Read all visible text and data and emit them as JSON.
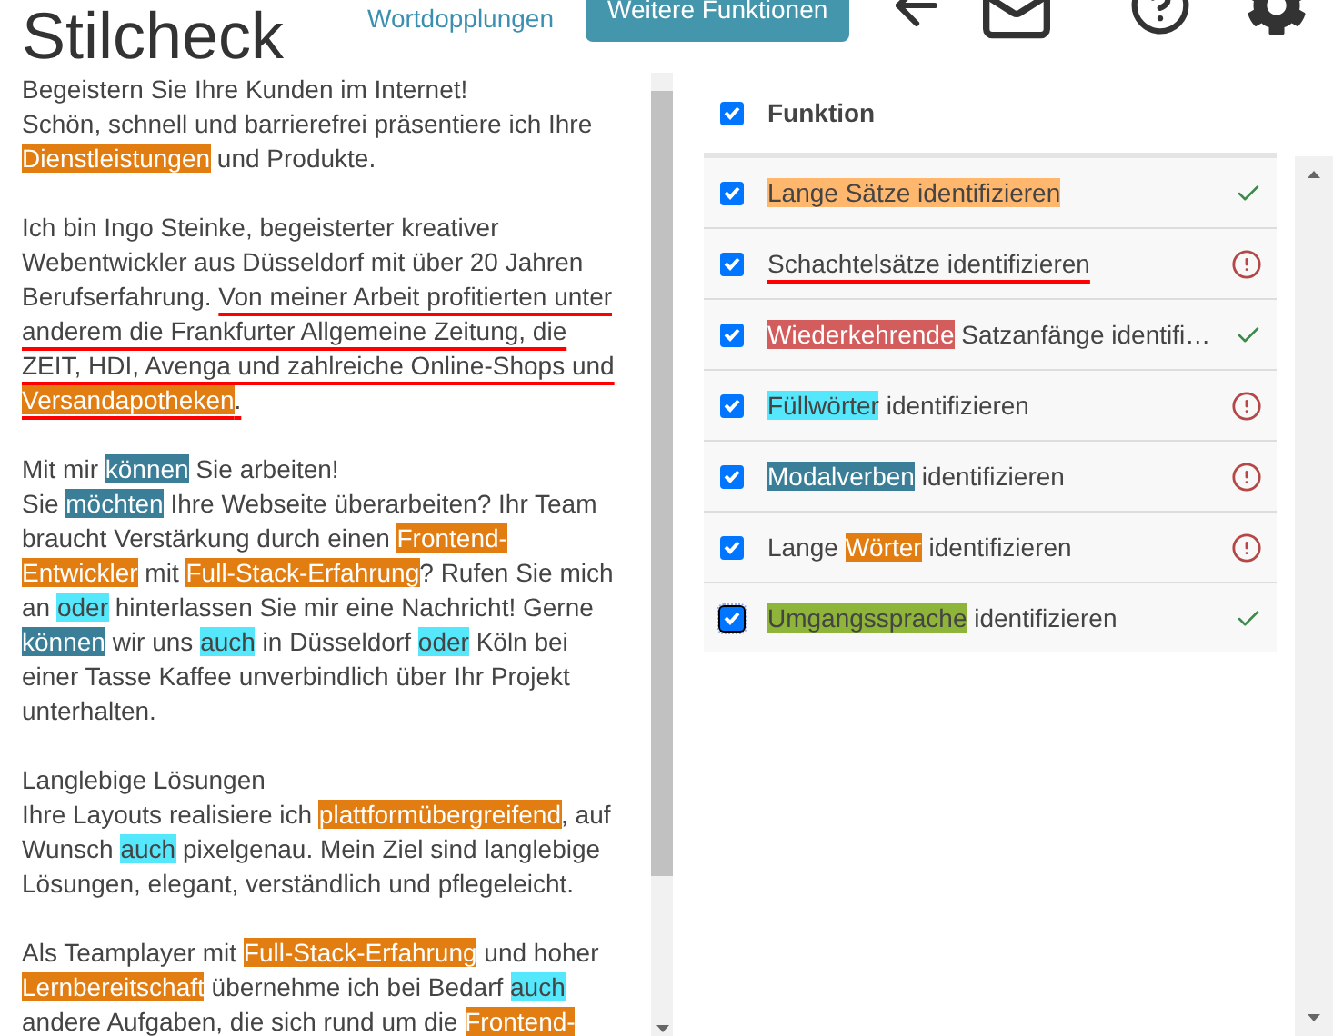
{
  "header": {
    "title": "Stilcheck",
    "link": "Wortdopplungen",
    "button": "Weitere Funktionen"
  },
  "text": [
    {
      "lines": [
        [
          {
            "kind": "plain",
            "text": "Begeistern Sie Ihre Kunden im Internet!"
          }
        ],
        [
          {
            "kind": "plain",
            "text": "Schön, schnell und barrierefrei präsentiere ich Ihre "
          },
          {
            "kind": "long_word",
            "text": "Dienstleistungen"
          },
          {
            "kind": "plain",
            "text": " und Produkte."
          }
        ]
      ]
    },
    {
      "lines": [
        [
          {
            "kind": "plain",
            "text": "Ich bin Ingo Steinke, begeisterter kreativer Webentwickler aus Düsseldorf mit über 20 Jahren Berufserfahrung. "
          },
          {
            "kind": "nested",
            "text": "Von meiner Arbeit profitierten unter anderem die Frankfurter Allgemeine Zeitung, die ZEIT, HDI, Avenga und zahlreiche Online-Shops und "
          },
          {
            "kind": "nested_long_word",
            "text": "Versandapotheken"
          },
          {
            "kind": "nested",
            "text": "."
          }
        ]
      ]
    },
    {
      "lines": [
        [
          {
            "kind": "plain",
            "text": "Mit mir "
          },
          {
            "kind": "modal",
            "text": "können"
          },
          {
            "kind": "plain",
            "text": " Sie arbeiten!"
          }
        ],
        [
          {
            "kind": "plain",
            "text": "Sie "
          },
          {
            "kind": "modal",
            "text": "möchten"
          },
          {
            "kind": "plain",
            "text": " Ihre Webseite überarbeiten? Ihr Team braucht Verstärkung durch einen "
          },
          {
            "kind": "long_word",
            "text": "Frontend-Entwickler"
          },
          {
            "kind": "plain",
            "text": " mit "
          },
          {
            "kind": "long_word",
            "text": "Full-Stack-Erfahrung"
          },
          {
            "kind": "plain",
            "text": "? Rufen Sie mich an "
          },
          {
            "kind": "filler",
            "text": "oder"
          },
          {
            "kind": "plain",
            "text": " hinterlassen Sie mir eine Nachricht! Gerne "
          },
          {
            "kind": "modal",
            "text": "können"
          },
          {
            "kind": "plain",
            "text": " wir uns "
          },
          {
            "kind": "filler",
            "text": "auch"
          },
          {
            "kind": "plain",
            "text": " in Düsseldorf "
          },
          {
            "kind": "filler",
            "text": "oder"
          },
          {
            "kind": "plain",
            "text": " Köln bei einer Tasse Kaffee unverbindlich über Ihr Projekt unterhalten."
          }
        ]
      ]
    },
    {
      "lines": [
        [
          {
            "kind": "plain",
            "text": "Langlebige Lösungen"
          }
        ],
        [
          {
            "kind": "plain",
            "text": "Ihre Layouts realisiere ich "
          },
          {
            "kind": "long_word",
            "text": "plattformübergreifend"
          },
          {
            "kind": "plain",
            "text": ", auf Wunsch "
          },
          {
            "kind": "filler",
            "text": "auch"
          },
          {
            "kind": "plain",
            "text": " pixelgenau. Mein Ziel sind langlebige Lösungen, elegant, verständlich und pflegeleicht."
          }
        ]
      ]
    },
    {
      "lines": [
        [
          {
            "kind": "plain",
            "text": "Als Teamplayer mit "
          },
          {
            "kind": "long_word",
            "text": "Full-Stack-Erfahrung"
          },
          {
            "kind": "plain",
            "text": " und hoher "
          },
          {
            "kind": "long_word",
            "text": "Lernbereitschaft"
          },
          {
            "kind": "plain",
            "text": " übernehme ich bei Bedarf "
          },
          {
            "kind": "filler",
            "text": "auch"
          },
          {
            "kind": "plain",
            "text": " andere Aufgaben, die sich rund um die "
          },
          {
            "kind": "long_word",
            "text": "Frontend-"
          }
        ]
      ]
    }
  ],
  "functions": {
    "header": {
      "label": "Funktion",
      "checked": true
    },
    "rows": [
      {
        "checked": true,
        "focused": false,
        "kind": "ok",
        "segments": [
          {
            "kind": "long_sentence",
            "text": "Lange Sätze identifizieren"
          }
        ]
      },
      {
        "checked": true,
        "focused": false,
        "kind": "warning",
        "segments": [
          {
            "kind": "nested",
            "text": "Schachtelsätze identifizieren"
          }
        ]
      },
      {
        "checked": true,
        "focused": false,
        "kind": "ok",
        "segments": [
          {
            "kind": "repeated",
            "text": "Wiederkehrende"
          },
          {
            "kind": "plain",
            "text": " Satzanfänge identifi…"
          }
        ]
      },
      {
        "checked": true,
        "focused": false,
        "kind": "warning",
        "segments": [
          {
            "kind": "filler",
            "text": "Füllwörter"
          },
          {
            "kind": "plain",
            "text": " identifizieren"
          }
        ]
      },
      {
        "checked": true,
        "focused": false,
        "kind": "warning",
        "segments": [
          {
            "kind": "modal",
            "text": "Modalverben"
          },
          {
            "kind": "plain",
            "text": " identifizieren"
          }
        ]
      },
      {
        "checked": true,
        "focused": false,
        "kind": "warning",
        "segments": [
          {
            "kind": "plain",
            "text": "Lange "
          },
          {
            "kind": "long_word",
            "text": "Wörter"
          },
          {
            "kind": "plain",
            "text": " identifizieren"
          }
        ]
      },
      {
        "checked": true,
        "focused": true,
        "kind": "ok",
        "segments": [
          {
            "kind": "colloquial",
            "text": "Umgangssprache"
          },
          {
            "kind": "plain",
            "text": " identifizieren"
          }
        ]
      }
    ]
  }
}
